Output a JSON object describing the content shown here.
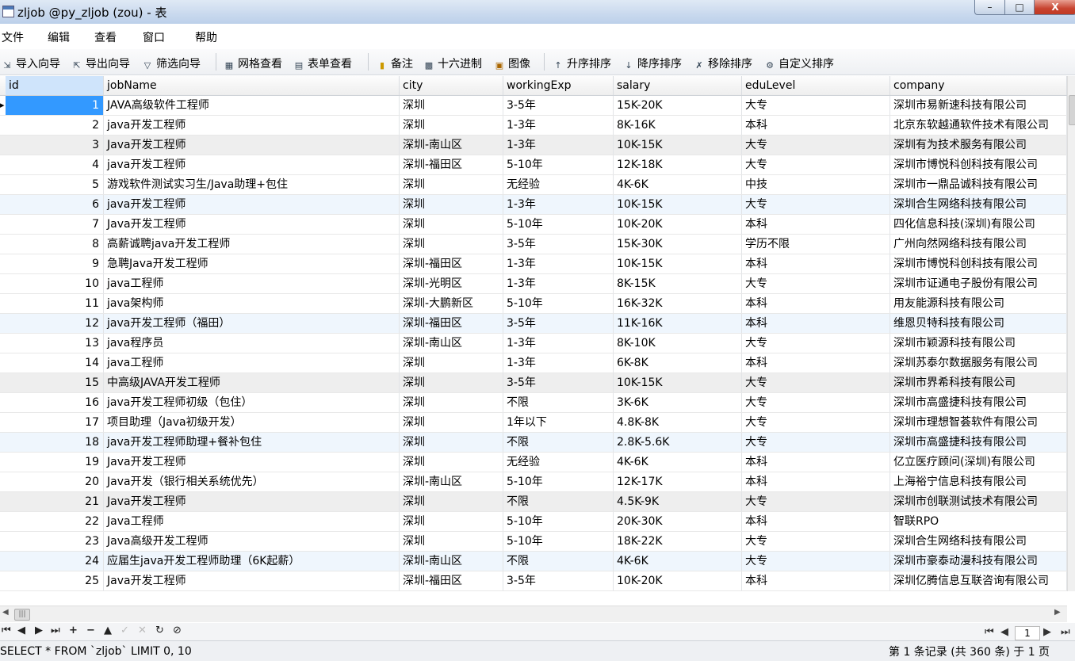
{
  "window": {
    "title": "zljob @py_zljob (zou) - 表",
    "min_label": "–",
    "max_label": "□",
    "close_label": "X"
  },
  "menu": [
    "文件",
    "编辑",
    "查看",
    "窗口",
    "帮助"
  ],
  "toolbar": [
    {
      "label": "导入向导",
      "icon": "import-wizard-icon"
    },
    {
      "label": "导出向导",
      "icon": "export-wizard-icon"
    },
    {
      "label": "筛选向导",
      "icon": "filter-wizard-icon"
    },
    {
      "label": "网格查看",
      "icon": "grid-view-icon"
    },
    {
      "label": "表单查看",
      "icon": "form-view-icon"
    },
    {
      "label": "备注",
      "icon": "memo-icon"
    },
    {
      "label": "十六进制",
      "icon": "hex-icon"
    },
    {
      "label": "图像",
      "icon": "image-icon"
    },
    {
      "label": "升序排序",
      "icon": "sort-asc-icon"
    },
    {
      "label": "降序排序",
      "icon": "sort-desc-icon"
    },
    {
      "label": "移除排序",
      "icon": "remove-sort-icon"
    },
    {
      "label": "自定义排序",
      "icon": "custom-sort-icon"
    }
  ],
  "table": {
    "columns": [
      "id",
      "jobName",
      "city",
      "workingExp",
      "salary",
      "eduLevel",
      "company"
    ],
    "rows": [
      [
        "1",
        "JAVA高级软件工程师",
        "深圳",
        "3-5年",
        "15K-20K",
        "大专",
        "深圳市易新速科技有限公司"
      ],
      [
        "2",
        "java开发工程师",
        "深圳",
        "1-3年",
        "8K-16K",
        "本科",
        "北京东软越通软件技术有限公司"
      ],
      [
        "3",
        "Java开发工程师",
        "深圳-南山区",
        "1-3年",
        "10K-15K",
        "大专",
        "深圳有为技术服务有限公司"
      ],
      [
        "4",
        "java开发工程师",
        "深圳-福田区",
        "5-10年",
        "12K-18K",
        "大专",
        "深圳市博悦科创科技有限公司"
      ],
      [
        "5",
        "游戏软件测试实习生/Java助理+包住",
        "深圳",
        "无经验",
        "4K-6K",
        "中技",
        "深圳市一鼎品诚科技有限公司"
      ],
      [
        "6",
        "java开发工程师",
        "深圳",
        "1-3年",
        "10K-15K",
        "大专",
        "深圳合生网络科技有限公司"
      ],
      [
        "7",
        "Java开发工程师",
        "深圳",
        "5-10年",
        "10K-20K",
        "本科",
        "四化信息科技(深圳)有限公司"
      ],
      [
        "8",
        "高薪诚聘java开发工程师",
        "深圳",
        "3-5年",
        "15K-30K",
        "学历不限",
        "广州向然网络科技有限公司"
      ],
      [
        "9",
        "急聘Java开发工程师",
        "深圳-福田区",
        "1-3年",
        "10K-15K",
        "本科",
        "深圳市博悦科创科技有限公司"
      ],
      [
        "10",
        "java工程师",
        "深圳-光明区",
        "1-3年",
        "8K-15K",
        "大专",
        "深圳市证通电子股份有限公司"
      ],
      [
        "11",
        "java架构师",
        "深圳-大鹏新区",
        "5-10年",
        "16K-32K",
        "本科",
        "用友能源科技有限公司"
      ],
      [
        "12",
        "java开发工程师（福田）",
        "深圳-福田区",
        "3-5年",
        "11K-16K",
        "本科",
        "维恩贝特科技有限公司"
      ],
      [
        "13",
        "java程序员",
        "深圳-南山区",
        "1-3年",
        "8K-10K",
        "大专",
        "深圳市颖源科技有限公司"
      ],
      [
        "14",
        "java工程师",
        "深圳",
        "1-3年",
        "6K-8K",
        "本科",
        "深圳苏泰尔数据服务有限公司"
      ],
      [
        "15",
        "中高级JAVA开发工程师",
        "深圳",
        "3-5年",
        "10K-15K",
        "大专",
        "深圳市界希科技有限公司"
      ],
      [
        "16",
        "java开发工程师初级（包住）",
        "深圳",
        "不限",
        "3K-6K",
        "大专",
        "深圳市高盛捷科技有限公司"
      ],
      [
        "17",
        "项目助理（Java初级开发）",
        "深圳",
        "1年以下",
        "4.8K-8K",
        "大专",
        "深圳市理想智荟软件有限公司"
      ],
      [
        "18",
        "java开发工程师助理+餐补包住",
        "深圳",
        "不限",
        "2.8K-5.6K",
        "大专",
        "深圳市高盛捷科技有限公司"
      ],
      [
        "19",
        "Java开发工程师",
        "深圳",
        "无经验",
        "4K-6K",
        "本科",
        "亿立医疗顾问(深圳)有限公司"
      ],
      [
        "20",
        "Java开发（银行相关系统优先）",
        "深圳-南山区",
        "5-10年",
        "12K-17K",
        "本科",
        "上海裕宁信息科技有限公司"
      ],
      [
        "21",
        "Java开发工程师",
        "深圳",
        "不限",
        "4.5K-9K",
        "大专",
        "深圳市创联测试技术有限公司"
      ],
      [
        "22",
        "Java工程师",
        "深圳",
        "5-10年",
        "20K-30K",
        "本科",
        "智联RPO"
      ],
      [
        "23",
        "Java高级开发工程师",
        "深圳",
        "5-10年",
        "18K-22K",
        "大专",
        "深圳合生网络科技有限公司"
      ],
      [
        "24",
        "应届生java开发工程师助理（6K起薪）",
        "深圳-南山区",
        "不限",
        "4K-6K",
        "大专",
        "深圳市豪泰动漫科技有限公司"
      ],
      [
        "25",
        "Java开发工程师",
        "深圳-福田区",
        "3-5年",
        "10K-20K",
        "本科",
        "深圳亿腾信息互联咨询有限公司"
      ]
    ]
  },
  "navbar": [
    "⏮",
    "◀",
    "▶",
    "⏭",
    "+",
    "−",
    "▲",
    "✓",
    "✕",
    "↻",
    "⊘"
  ],
  "status": {
    "sql": "SELECT * FROM `zljob` LIMIT 0, 10",
    "records": "第 1 条记录 (共 360 条) 于 1 页"
  },
  "pager": {
    "page": "1",
    "first": "⏮",
    "prev": "◀",
    "next": "▶",
    "last": "⏭"
  },
  "colors": {
    "selected_cell": "#3399ff",
    "row_alt": "#eff6fd",
    "row_gray": "#eeeeee",
    "header_sel": "#cfe4fb"
  }
}
